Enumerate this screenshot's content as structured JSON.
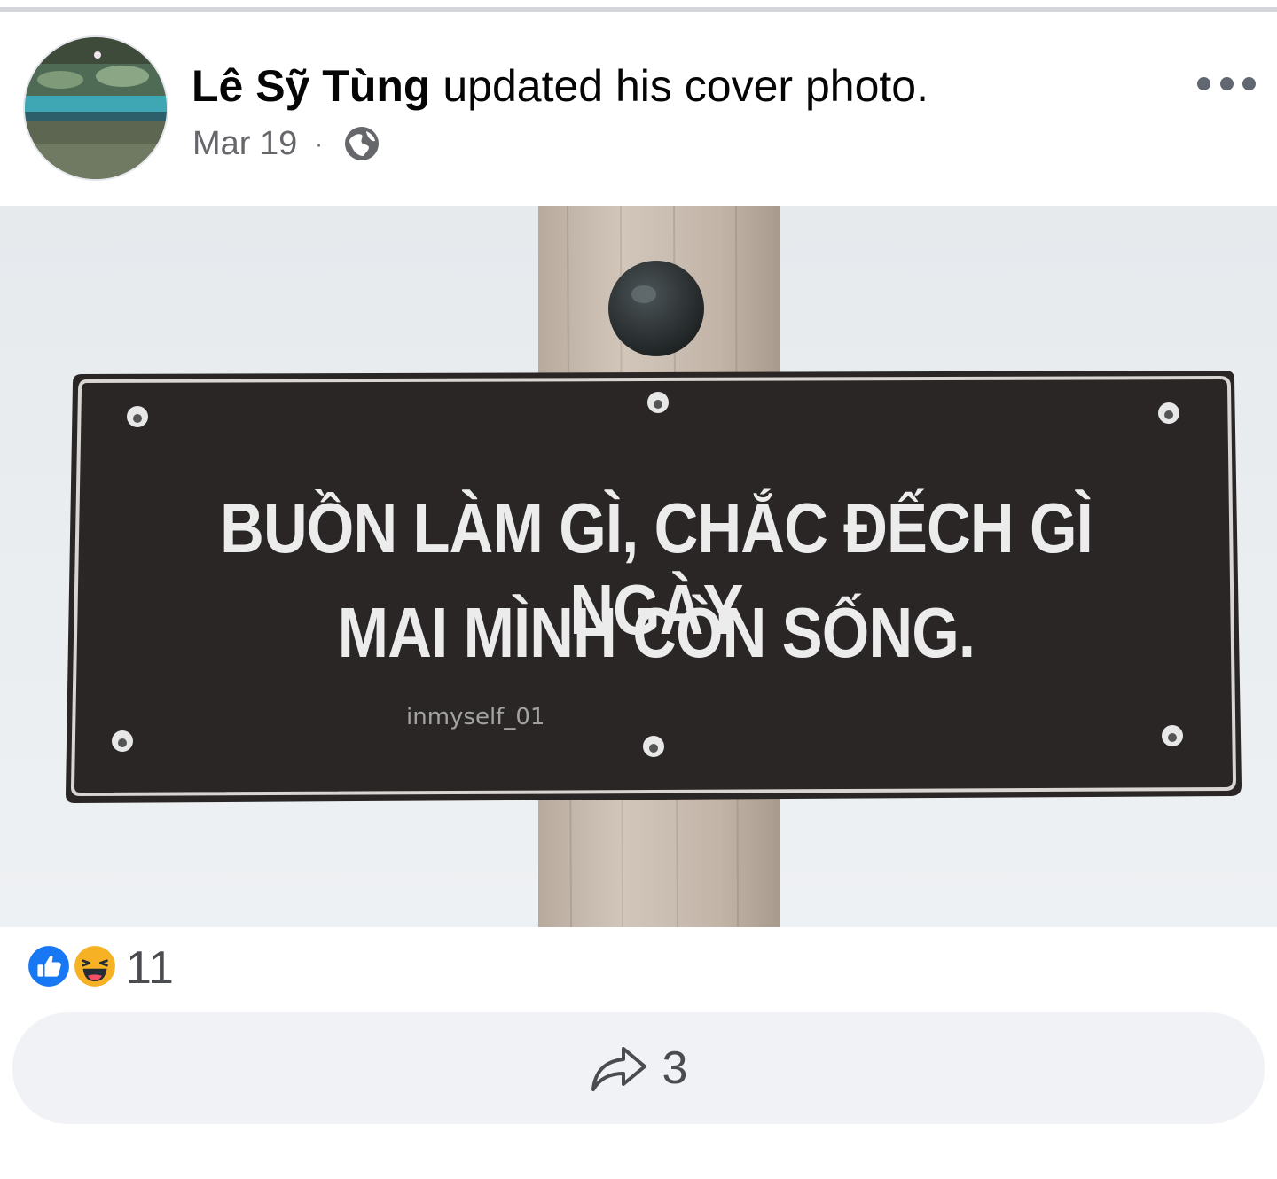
{
  "post": {
    "author": "Lê Sỹ Tùng",
    "action": "updated his cover photo.",
    "date": "Mar 19",
    "separator": "·",
    "privacy_icon": "globe-icon",
    "more_icon": "more-options-icon"
  },
  "photo": {
    "line1": "BUỒN LÀM GÌ, CHẮC ĐẾCH GÌ NGÀY",
    "line2": "MAI MÌNH CÒN SỐNG.",
    "watermark": "inmyself_01"
  },
  "reactions": {
    "icons": [
      "like-icon",
      "haha-icon"
    ],
    "count": "11"
  },
  "share": {
    "icon": "share-icon",
    "count": "3"
  },
  "colors": {
    "like_blue": "#1877f2",
    "haha_yellow": "#f7b125",
    "secondary_text": "#65676b",
    "button_bg": "#f0f2f5"
  }
}
